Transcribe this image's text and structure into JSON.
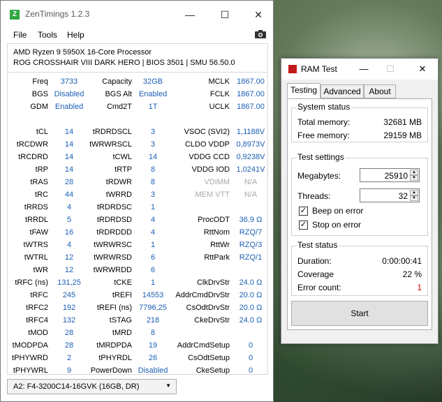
{
  "zentimings": {
    "title": "ZenTimings 1.2.3",
    "logo_letter": "Z",
    "menu": [
      "File",
      "Tools",
      "Help"
    ],
    "cpu": "AMD Ryzen 9 5950X 16-Core Processor",
    "board": "ROG CROSSHAIR VIII DARK HERO | BIOS 3501 | SMU 56.50.0",
    "col1": [
      [
        "Freq",
        "3733"
      ],
      [
        "BGS",
        "Disabled"
      ],
      [
        "GDM",
        "Enabled"
      ],
      [
        "",
        ""
      ],
      [
        "tCL",
        "14"
      ],
      [
        "tRCDWR",
        "14"
      ],
      [
        "tRCDRD",
        "14"
      ],
      [
        "tRP",
        "14"
      ],
      [
        "tRAS",
        "28"
      ],
      [
        "tRC",
        "44"
      ],
      [
        "tRRDS",
        "4"
      ],
      [
        "tRRDL",
        "5"
      ],
      [
        "tFAW",
        "16"
      ],
      [
        "tWTRS",
        "4"
      ],
      [
        "tWTRL",
        "12"
      ],
      [
        "tWR",
        "12"
      ],
      [
        "tRFC (ns)",
        "131,25"
      ],
      [
        "tRFC",
        "245"
      ],
      [
        "tRFC2",
        "192"
      ],
      [
        "tRFC4",
        "132"
      ],
      [
        "tMOD",
        "28"
      ],
      [
        "tMODPDA",
        "28"
      ],
      [
        "tPHYWRD",
        "2"
      ],
      [
        "tPHYWRL",
        "9"
      ]
    ],
    "col2": [
      [
        "Capacity",
        "32GB"
      ],
      [
        "BGS Alt",
        "Enabled"
      ],
      [
        "Cmd2T",
        "1T"
      ],
      [
        "",
        ""
      ],
      [
        "tRDRDSCL",
        "3"
      ],
      [
        "tWRWRSCL",
        "3"
      ],
      [
        "tCWL",
        "14"
      ],
      [
        "tRTP",
        "8"
      ],
      [
        "tRDWR",
        "8"
      ],
      [
        "tWRRD",
        "3"
      ],
      [
        "tRDRDSC",
        "1"
      ],
      [
        "tRDRDSD",
        "4"
      ],
      [
        "tRDRDDD",
        "4"
      ],
      [
        "tWRWRSC",
        "1"
      ],
      [
        "tWRWRSD",
        "6"
      ],
      [
        "tWRWRDD",
        "6"
      ],
      [
        "tCKE",
        "1"
      ],
      [
        "tREFI",
        "14553"
      ],
      [
        "tREFI (ns)",
        "7796,25"
      ],
      [
        "tSTAG",
        "218"
      ],
      [
        "tMRD",
        "8"
      ],
      [
        "tMRDPDA",
        "19"
      ],
      [
        "tPHYRDL",
        "26"
      ],
      [
        "PowerDown",
        "Disabled"
      ]
    ],
    "col3": [
      [
        "MCLK",
        "1867.00"
      ],
      [
        "FCLK",
        "1867.00"
      ],
      [
        "UCLK",
        "1867.00"
      ],
      [
        "",
        ""
      ],
      [
        "VSOC (SVI2)",
        "1,1188V"
      ],
      [
        "CLDO VDDP",
        "0,8973V"
      ],
      [
        "VDDG CCD",
        "0,9238V"
      ],
      [
        "VDDG IOD",
        "1,0241V"
      ],
      [
        "VDIMM",
        "N/A"
      ],
      [
        "MEM VTT",
        "N/A"
      ],
      [
        "",
        ""
      ],
      [
        "ProcODT",
        "36.9 Ω"
      ],
      [
        "RttNom",
        "RZQ/7"
      ],
      [
        "RttWr",
        "RZQ/3"
      ],
      [
        "RttPark",
        "RZQ/1"
      ],
      [
        "",
        ""
      ],
      [
        "ClkDrvStr",
        "24.0 Ω"
      ],
      [
        "AddrCmdDrvStr",
        "20.0 Ω"
      ],
      [
        "CsOdtDrvStr",
        "20.0 Ω"
      ],
      [
        "CkeDrvStr",
        "24.0 Ω"
      ],
      [
        "",
        ""
      ],
      [
        "AddrCmdSetup",
        "0"
      ],
      [
        "CsOdtSetup",
        "0"
      ],
      [
        "CkeSetup",
        "0"
      ]
    ],
    "dimm_select": "A2: F4-3200C14-16GVK (16GB, DR)"
  },
  "ramtest": {
    "title": "RAM Test",
    "tabs": [
      "Testing",
      "Advanced",
      "About"
    ],
    "system_status": {
      "title": "System status",
      "total_label": "Total memory:",
      "total_value": "32681 MB",
      "free_label": "Free memory:",
      "free_value": "29159 MB"
    },
    "test_settings": {
      "title": "Test settings",
      "megabytes_label": "Megabytes:",
      "megabytes_value": "25910",
      "threads_label": "Threads:",
      "threads_value": "32",
      "beep_label": "Beep on error",
      "stop_label": "Stop on error"
    },
    "test_status": {
      "title": "Test status",
      "duration_label": "Duration:",
      "duration_value": "0:00:00:41",
      "coverage_label": "Coverage",
      "coverage_value": "22 %",
      "errors_label": "Error count:",
      "errors_value": "1"
    },
    "start_label": "Start",
    "error_color": "#d00000"
  }
}
